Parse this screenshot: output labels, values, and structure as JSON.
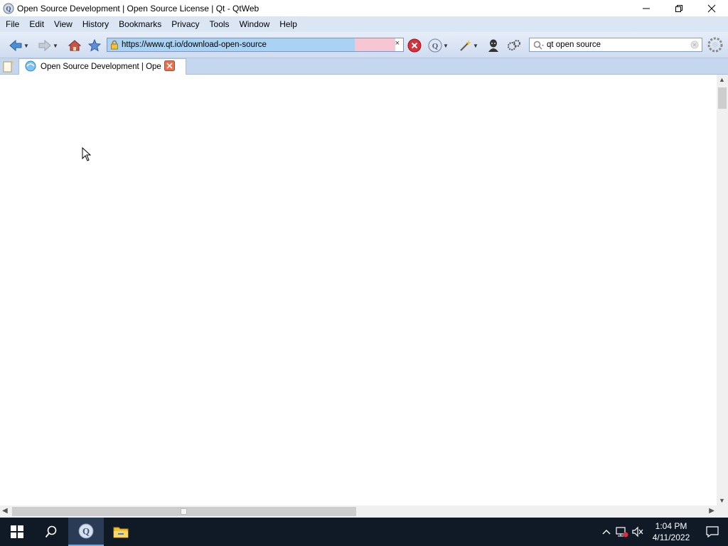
{
  "window": {
    "title": "Open Source Development | Open Source License | Qt - QtWeb",
    "minimize_icon": "minimize-icon",
    "maximize_icon": "restore-icon",
    "close_icon": "close-icon"
  },
  "menu": {
    "items": [
      "File",
      "Edit",
      "View",
      "History",
      "Bookmarks",
      "Privacy",
      "Tools",
      "Window",
      "Help"
    ]
  },
  "toolbar": {
    "url": "https://www.qt.io/download-open-source",
    "search_value": "qt open source",
    "clear_label": "×",
    "colors": {
      "progress": "#a9d2f3",
      "progress_pink": "#f6c6d3",
      "stop": "#d9303a"
    }
  },
  "tabs": [
    {
      "title": "Open Source Development | Open...",
      "active": true
    }
  ],
  "taskbar": {
    "time": "1:04 PM",
    "date": "4/11/2022"
  }
}
